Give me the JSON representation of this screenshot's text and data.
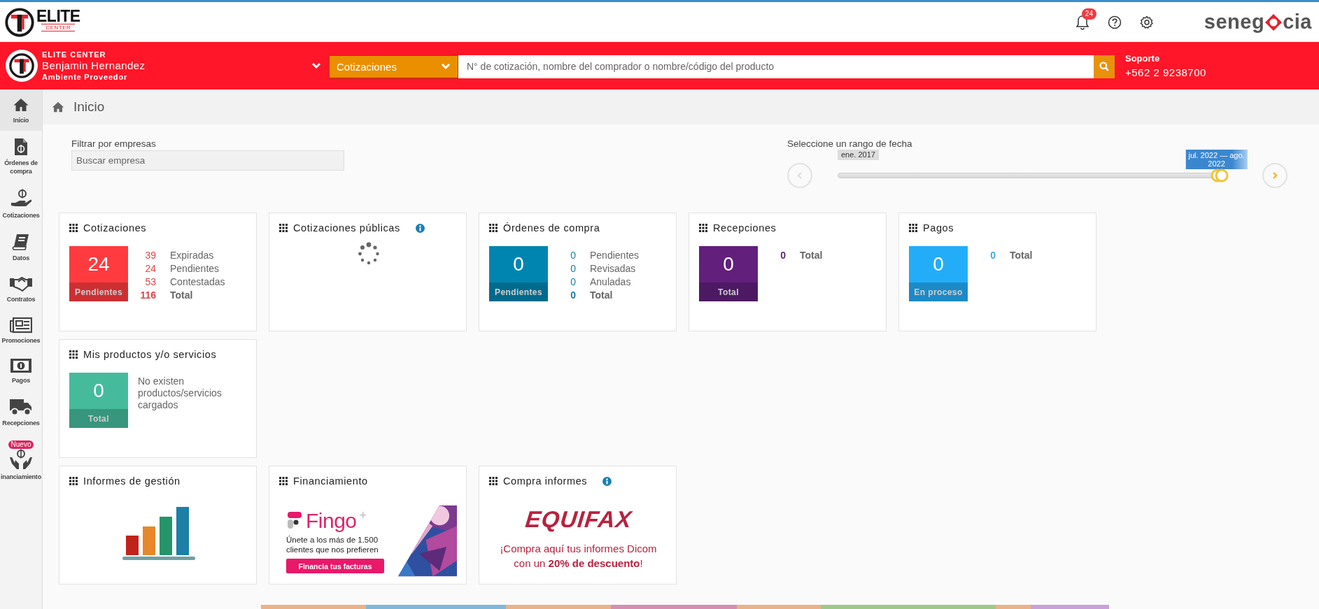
{
  "header": {
    "logo_name": "ELITE",
    "logo_tagline": "CENTER",
    "notifications": {
      "count": "24"
    },
    "brand_start": "seneg",
    "brand_end": "cia"
  },
  "user_bar": {
    "company": "ELITE CENTER",
    "user": "Benjamin Hernandez",
    "environment": "Ambiente Proveedor",
    "search_category": "Cotizaciones",
    "search": {
      "placeholder": "N° de cotización, nombre del comprador o nombre/código del producto"
    },
    "support": {
      "label": "Soporte",
      "phone": "+562 2 9238700"
    }
  },
  "sidebar": {
    "items": [
      {
        "label": "Inicio",
        "selected": true
      },
      {
        "label": "Órdenes de compra",
        "selected": false
      },
      {
        "label": "Cotizaciones",
        "selected": false
      },
      {
        "label": "Datos",
        "selected": false
      },
      {
        "label": "Contratos",
        "selected": false
      },
      {
        "label": "Promociones",
        "selected": false
      },
      {
        "label": "Pagos",
        "selected": false
      },
      {
        "label": "Recepciones",
        "selected": false
      },
      {
        "label": "inanciamiento",
        "badge": "Nuevo",
        "selected": false
      }
    ]
  },
  "breadcrumb": "Inicio",
  "filter": {
    "label": "Filtrar por empresas",
    "placeholder": "Buscar empresa"
  },
  "date_range": {
    "label": "Seleccione un rango de fecha",
    "start_label": "ene. 2017",
    "end_label": "jul. 2022 — ago. 2022",
    "level": 0.98
  },
  "card_rows": [
    [
      {
        "kind": "stats",
        "title": "Cotizaciones",
        "tile": {
          "value": "24",
          "caption": "Pendientes",
          "color": "#ff3b3f"
        },
        "lines": [
          {
            "count": "39",
            "label": "Expiradas",
            "kind": "line"
          },
          {
            "count": "24",
            "label": "Pendientes",
            "kind": "line"
          },
          {
            "count": "53",
            "label": "Contestadas",
            "kind": "line"
          },
          {
            "count": "116",
            "label": "Total",
            "kind": "total"
          }
        ]
      },
      {
        "kind": "loading",
        "title": "Cotizaciones públicas",
        "info": true
      },
      {
        "kind": "stats",
        "title": "Órdenes de compra",
        "tile": {
          "value": "0",
          "caption": "Pendientes",
          "color": "#0085b0"
        },
        "lines": [
          {
            "count": "0",
            "label": "Pendientes",
            "kind": "line"
          },
          {
            "count": "0",
            "label": "Revisadas",
            "kind": "line"
          },
          {
            "count": "0",
            "label": "Anuladas",
            "kind": "line"
          },
          {
            "count": "0",
            "label": "Total",
            "kind": "total"
          }
        ]
      },
      {
        "kind": "stats",
        "title": "Recepciones",
        "tile": {
          "value": "0",
          "caption": "Total",
          "color": "#621f7c"
        },
        "lines": [
          {
            "count": "0",
            "label": "Total",
            "kind": "total"
          }
        ]
      },
      {
        "kind": "stats",
        "title": "Pagos",
        "tile": {
          "value": "0",
          "caption": "En proceso",
          "color": "#23adf9"
        },
        "lines": [
          {
            "count": "0",
            "label": "Total",
            "kind": "total"
          }
        ]
      }
    ],
    [
      {
        "kind": "empty",
        "title": "Mis productos y/o servicios",
        "tile": {
          "value": "0",
          "caption": "Total",
          "color": "#45bb9c"
        },
        "message": "No existen productos/servicios cargados"
      }
    ],
    [
      {
        "kind": "chart-art",
        "title": "Informes de gestión"
      },
      {
        "kind": "fingo",
        "title": "Financiamiento",
        "brand": "Fingo",
        "brand_mark": "+",
        "text": "Únete a los más de 1.500 clientes que nos prefieren",
        "button": "Financia tus facturas"
      },
      {
        "kind": "equifax",
        "title": "Compra informes",
        "info": true,
        "brand": "EQUIFAX",
        "text": "¡Compra aquí tus informes Dicom con un **20% de descuento**!"
      }
    ]
  ]
}
